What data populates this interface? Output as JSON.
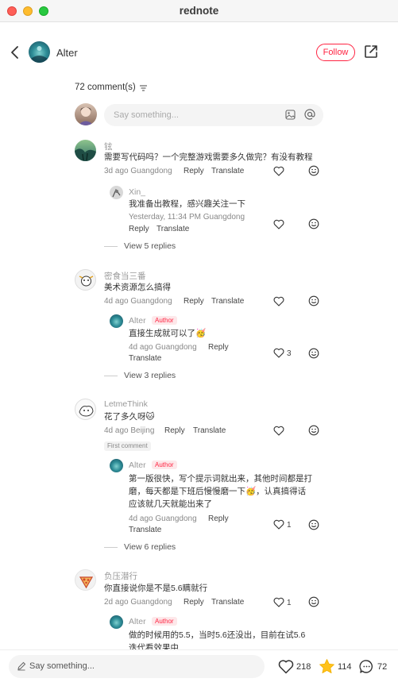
{
  "window": {
    "title": "rednote"
  },
  "header": {
    "author": "Alter",
    "follow_label": "Follow"
  },
  "comments_header": {
    "count_label": "72 comment(s)"
  },
  "input": {
    "placeholder": "Say something..."
  },
  "labels": {
    "reply": "Reply",
    "translate": "Translate",
    "author_tag": "Author",
    "first_comment": "First comment"
  },
  "comments": [
    {
      "user": "铉",
      "text": "需要写代码吗？一个完整游戏需要多久做完？有没有教程",
      "meta": "3d ago Guangdong",
      "replies": [
        {
          "user": "Xin_",
          "text": "我准备出教程，感兴趣关注一下",
          "meta": "Yesterday, 11:34 PM Guangdong"
        }
      ],
      "view_more": "View 5 replies"
    },
    {
      "user": "密食当三番",
      "text": "美术资源怎么搞得",
      "meta": "4d ago Guangdong",
      "replies": [
        {
          "user": "Alter",
          "text": "直接生成就可以了🥳",
          "meta": "4d ago Guangdong",
          "likes": "3"
        }
      ],
      "view_more": "View 3 replies"
    },
    {
      "user": "LetmeThink",
      "text": "花了多久呀🐱",
      "meta": "4d ago Beijing",
      "replies": [
        {
          "user": "Alter",
          "text_lines": [
            "第一版很快，写个提示词就出来，其他时间都是打",
            "磨，每天都是下班后慢慢磨一下🥳，认真搞得话",
            "应该就几天就能出来了"
          ],
          "meta": "4d ago Guangdong",
          "likes": "1"
        }
      ],
      "view_more": "View 6 replies"
    },
    {
      "user": "负压潜行",
      "text": "你直接说你是不是5.6瞒就行",
      "meta": "2d ago Guangdong",
      "likes": "1",
      "replies": [
        {
          "user": "Alter",
          "text_lines": [
            "做的时候用的5.5，当时5.6还没出，目前在试5.6",
            "迭代看效果中"
          ]
        }
      ]
    }
  ],
  "bottom_bar": {
    "placeholder": "Say something...",
    "likes": "218",
    "stars": "114",
    "comments": "72"
  },
  "colors": {
    "accent": "#ff2442",
    "star": "#ffc21c",
    "author_tag_bg": "#fde8ea"
  }
}
